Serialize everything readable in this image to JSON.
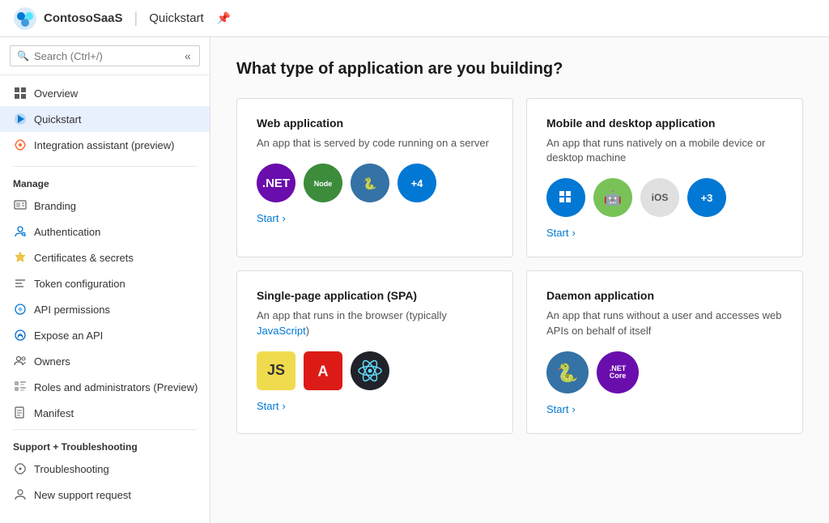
{
  "topbar": {
    "app_name": "ContosoSaaS",
    "separator": "|",
    "page": "Quickstart",
    "pin_icon": "📌"
  },
  "sidebar": {
    "search_placeholder": "Search (Ctrl+/)",
    "nav": {
      "overview": "Overview",
      "quickstart": "Quickstart",
      "integration": "Integration assistant (preview)"
    },
    "manage_label": "Manage",
    "manage_items": [
      {
        "label": "Branding",
        "icon": "branding"
      },
      {
        "label": "Authentication",
        "icon": "auth"
      },
      {
        "label": "Certificates & secrets",
        "icon": "certs"
      },
      {
        "label": "Token configuration",
        "icon": "token"
      },
      {
        "label": "API permissions",
        "icon": "api"
      },
      {
        "label": "Expose an API",
        "icon": "expose"
      },
      {
        "label": "Owners",
        "icon": "owners"
      },
      {
        "label": "Roles and administrators (Preview)",
        "icon": "roles"
      },
      {
        "label": "Manifest",
        "icon": "manifest"
      }
    ],
    "support_label": "Support + Troubleshooting",
    "support_items": [
      {
        "label": "Troubleshooting",
        "icon": "trouble"
      },
      {
        "label": "New support request",
        "icon": "support"
      }
    ]
  },
  "content": {
    "page_title": "What type of application are you building?",
    "cards": [
      {
        "id": "web",
        "title": "Web application",
        "desc": "An app that is served by code running on a server",
        "start_label": "Start",
        "icons": [
          ".NET",
          "Node",
          "Py",
          "+4"
        ]
      },
      {
        "id": "mobile",
        "title": "Mobile and desktop application",
        "desc": "An app that runs natively on a mobile device or desktop machine",
        "start_label": "Start",
        "icons": [
          "Win",
          "Android",
          "iOS",
          "+3"
        ]
      },
      {
        "id": "spa",
        "title": "Single-page application (SPA)",
        "desc": "An app that runs in the browser (typically JavaScript)",
        "start_label": "Start",
        "icons": [
          "JS",
          "Angular",
          "React"
        ]
      },
      {
        "id": "daemon",
        "title": "Daemon application",
        "desc": "An app that runs without a user and accesses web APIs on behalf of itself",
        "start_label": "Start",
        "icons": [
          "Python",
          ".NET Core"
        ]
      }
    ]
  }
}
